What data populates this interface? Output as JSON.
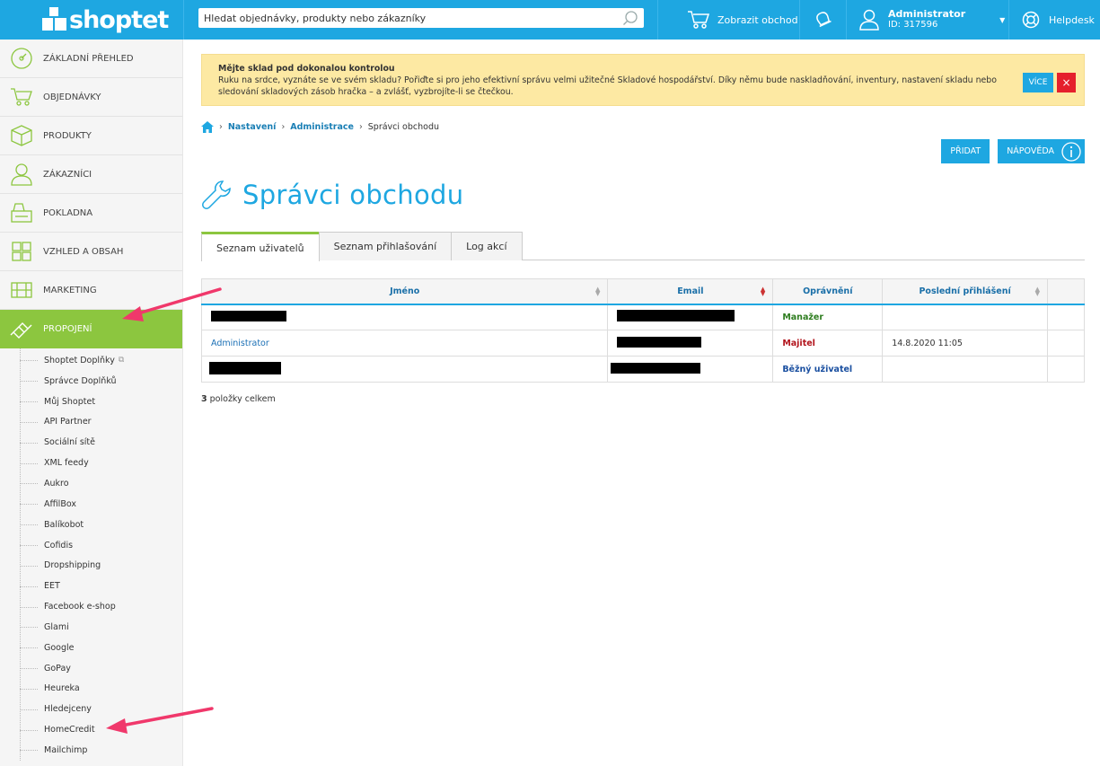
{
  "brand": {
    "logo_text": "shoptet",
    "primary_color": "#1ea7e1",
    "active_color": "#8cc63f"
  },
  "topbar": {
    "search_placeholder": "Hledat objednávky, produkty nebo zákazníky",
    "show_shop": "Zobrazit obchod",
    "user_name": "Administrator",
    "user_id": "ID: 317596",
    "helpdesk": "Helpdesk"
  },
  "sidebar": {
    "items": [
      {
        "label": "ZÁKLADNÍ PŘEHLED",
        "icon": "dashboard-icon"
      },
      {
        "label": "OBJEDNÁVKY",
        "icon": "cart-icon"
      },
      {
        "label": "PRODUKTY",
        "icon": "box-icon"
      },
      {
        "label": "ZÁKAZNÍCI",
        "icon": "user-icon"
      },
      {
        "label": "POKLADNA",
        "icon": "register-icon"
      },
      {
        "label": "VZHLED A OBSAH",
        "icon": "layout-icon"
      },
      {
        "label": "MARKETING",
        "icon": "marketing-icon"
      },
      {
        "label": "PROPOJENÍ",
        "icon": "connect-icon",
        "active": true
      }
    ],
    "subitems": [
      "Shoptet Doplňky",
      "Správce Doplňků",
      "Můj Shoptet",
      "API Partner",
      "Sociální sítě",
      "XML feedy",
      "Aukro",
      "AffilBox",
      "Balíkobot",
      "Cofidis",
      "Dropshipping",
      "EET",
      "Facebook e-shop",
      "Glami",
      "Google",
      "GoPay",
      "Heureka",
      "Hledejceny",
      "HomeCredit",
      "Mailchimp"
    ]
  },
  "alert": {
    "title": "Mějte sklad pod dokonalou kontrolou",
    "body": "Ruku na srdce, vyznáte se ve svém skladu? Pořiďte si pro jeho efektivní správu velmi užitečné Skladové hospodářství. Díky němu bude naskladňování, inventury, nastavení skladu nebo sledování skladových zásob hračka – a zvlášť, vyzbrojíte-li se čtečkou.",
    "more_label": "VÍCE",
    "close_label": "×"
  },
  "breadcrumb": {
    "level1": "Nastavení",
    "level2": "Administrace",
    "current": "Správci obchodu"
  },
  "actions": {
    "add": "PŘIDAT",
    "help": "NÁPOVĚDA"
  },
  "page": {
    "title": "Správci obchodu"
  },
  "tabs": [
    "Seznam uživatelů",
    "Seznam přihlašování",
    "Log akcí"
  ],
  "table": {
    "headers": [
      "Jméno",
      "Email",
      "Oprávnění",
      "Poslední přihlášení"
    ],
    "rows": [
      {
        "name": "",
        "email": "",
        "permission": "Manažer",
        "last_login": ""
      },
      {
        "name": "Administrator",
        "email": "",
        "permission": "Majitel",
        "last_login": "14.8.2020 11:05"
      },
      {
        "name": "",
        "email": "",
        "permission": "Běžný uživatel",
        "last_login": ""
      }
    ],
    "total_count": "3",
    "total_label": " položky celkem"
  }
}
